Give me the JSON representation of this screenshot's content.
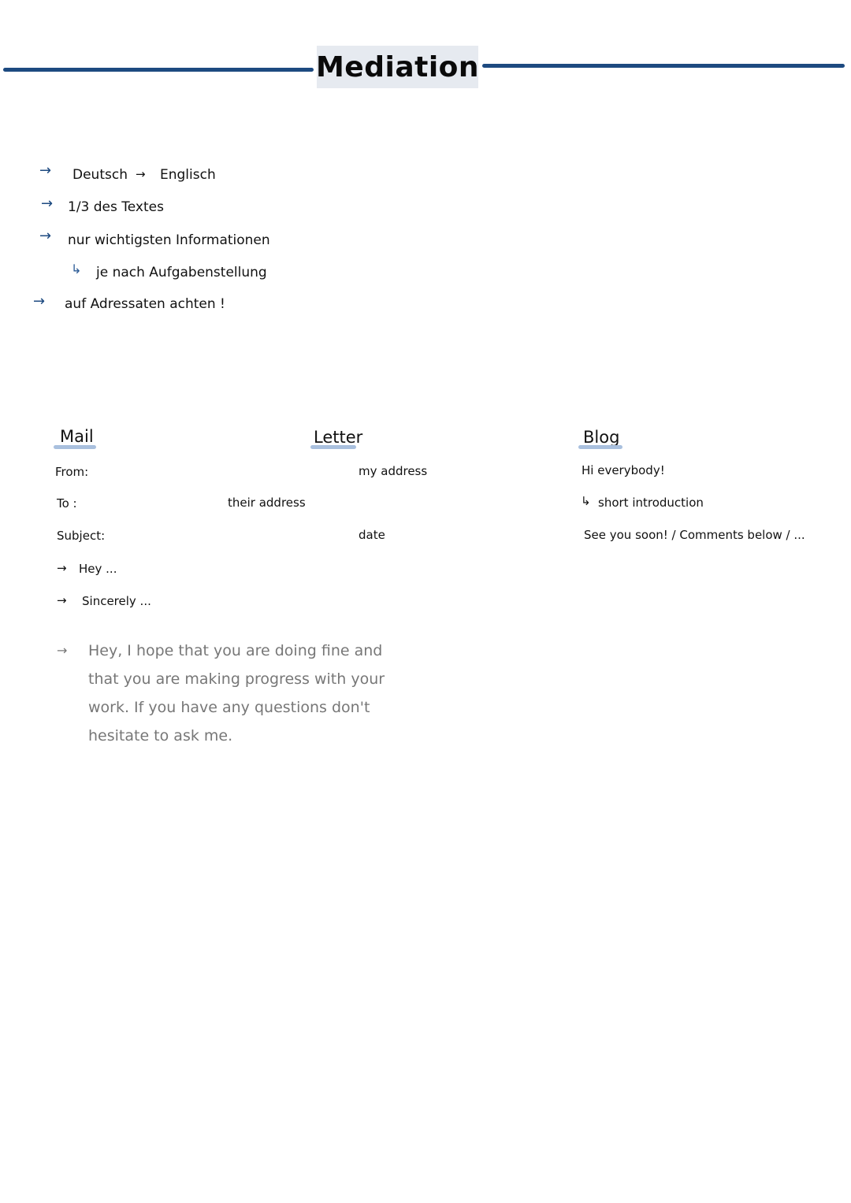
{
  "title": "Mediation",
  "bullets": [
    {
      "icon": "arrow-right-icon",
      "text": "Deutsch",
      "arrow_between": "arrow-right-icon",
      "text2": "Englisch"
    },
    {
      "icon": "arrow-right-icon",
      "text": "1/3 des Textes"
    },
    {
      "icon": "arrow-right-icon",
      "text": "nur wichtigsten Informationen"
    },
    {
      "icon": "return-arrow-icon",
      "text": "je nach Aufgabenstellung"
    },
    {
      "icon": "arrow-right-icon",
      "text": "auf Adressaten achten !"
    }
  ],
  "mail": {
    "heading": "Mail",
    "from": "From:",
    "to": "To :",
    "subject": "Subject:",
    "greeting": "Hey ...",
    "closing": "Sincerely ..."
  },
  "letter": {
    "heading": "Letter",
    "my_address": "my address",
    "their_address": "their address",
    "date": "date"
  },
  "blog": {
    "heading": "Blog",
    "greeting": "Hi everybody!",
    "intro": "short introduction",
    "closing": "See you soon! / Comments below / ..."
  },
  "example": {
    "text": "Hey, I hope that you are doing fine and that you are making progress with your work. If you have any questions don't hesitate to ask me."
  },
  "icons": {
    "arrow": "→",
    "return_arrow": "↳"
  },
  "colors": {
    "accent": "#1d4a80",
    "title_bg": "#e6eaf0",
    "underline": "#a9c0de",
    "example_text": "#777777"
  }
}
